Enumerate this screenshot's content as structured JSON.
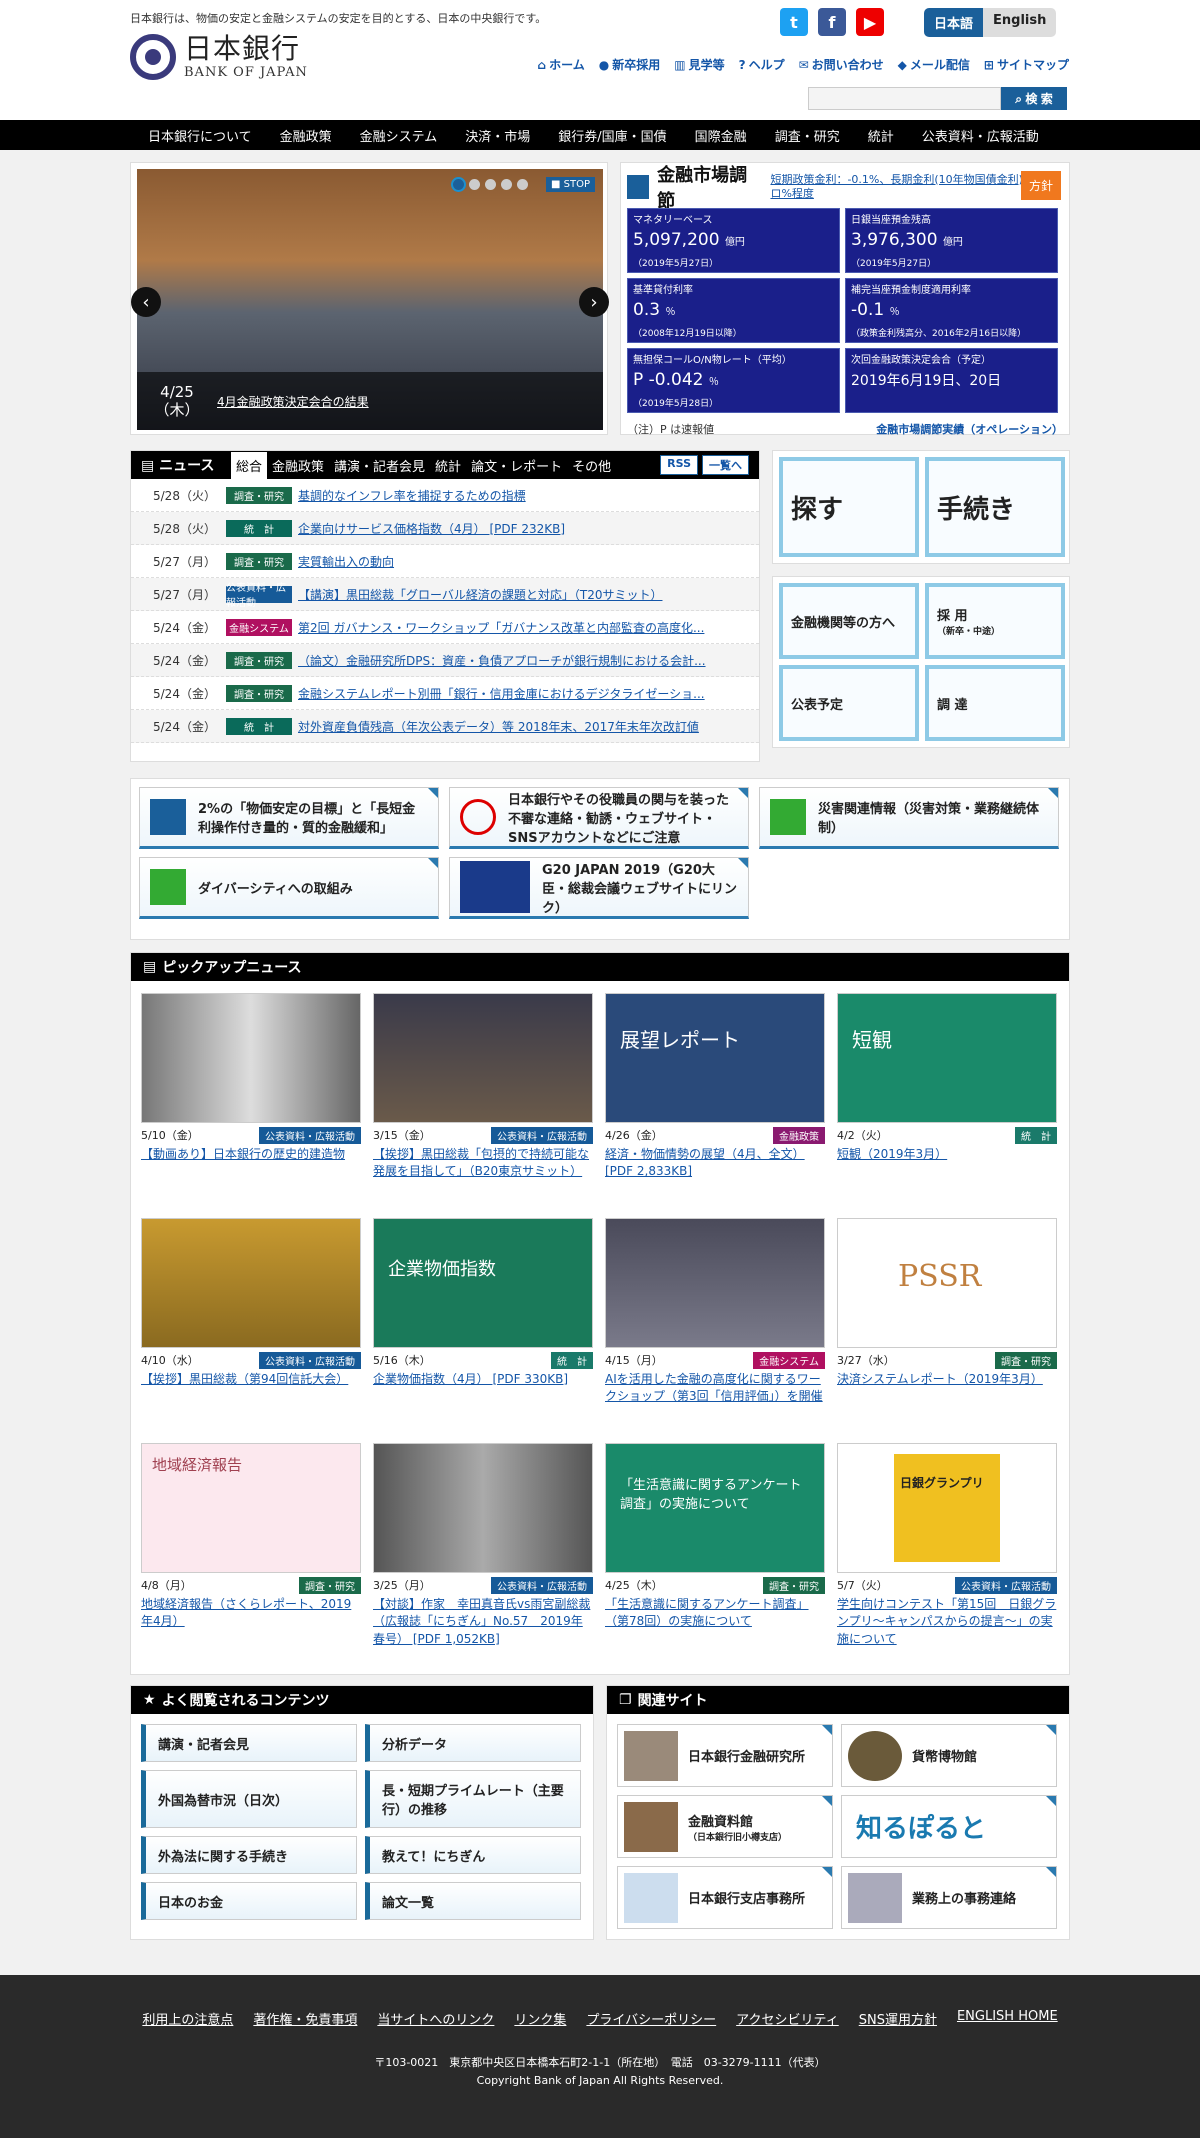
{
  "header": {
    "tagline": "日本銀行は、物価の安定と金融システムの安定を目的とする、日本の中央銀行です。",
    "logo_jp": "日本銀行",
    "logo_en": "BANK OF JAPAN",
    "lang_ja": "日本語",
    "lang_en": "English",
    "social": [
      "t",
      "f",
      "▶"
    ],
    "util": [
      "ホーム",
      "新卒採用",
      "見学等",
      "ヘルプ",
      "お問い合わせ",
      "メール配信",
      "サイトマップ"
    ],
    "search_button": "検 索"
  },
  "gnav": [
    "日本銀行について",
    "金融政策",
    "金融システム",
    "決済・市場",
    "銀行券/国庫・国債",
    "国際金融",
    "調査・研究",
    "統計",
    "公表資料・広報活動"
  ],
  "slideshow": {
    "stop": "STOP",
    "date": "4/25",
    "weekday": "（木）",
    "caption": "4月金融政策決定会合の結果"
  },
  "market": {
    "title": "金融市場調節",
    "rate_text": "短期政策金利：-0.1%、長期金利(10年物国債金利)：ゼロ%程度",
    "policy_button": "方針",
    "cells": [
      {
        "label": "マネタリーベース",
        "value": "5,097,200",
        "unit": "億円",
        "note": "（2019年5月27日）"
      },
      {
        "label": "日銀当座預金残高",
        "value": "3,976,300",
        "unit": "億円",
        "note": "（2019年5月27日）"
      },
      {
        "label": "基準貸付利率",
        "value": "0.3",
        "unit": "％",
        "note": "（2008年12月19日以降）"
      },
      {
        "label": "補完当座預金制度適用利率",
        "value": "-0.1",
        "unit": "％",
        "note": "（政策金利残高分、2016年2月16日以降）"
      },
      {
        "label": "無担保コールO/N物レート（平均）",
        "value": "P -0.042",
        "unit": "％",
        "note": "（2019年5月28日）"
      },
      {
        "label": "次回金融政策決定会合（予定）",
        "value": "2019年6月19日、20日",
        "unit": "",
        "note": ""
      }
    ],
    "footnote": "（注）P は速報値",
    "ops_link": "金融市場調節実績（オペレーション）"
  },
  "news": {
    "title": "ニュース",
    "tabs": [
      "総合",
      "金融政策",
      "講演・記者会見",
      "統計",
      "論文・レポート",
      "その他"
    ],
    "rss": "RSS",
    "list_btn": "一覧へ",
    "items": [
      {
        "date": "5/28（火）",
        "cat": "調査・研究",
        "text": "基調的なインフレ率を捕捉するための指標"
      },
      {
        "date": "5/28（火）",
        "cat": "統　計",
        "text": "企業向けサービス価格指数（4月） [PDF 232KB]"
      },
      {
        "date": "5/27（月）",
        "cat": "調査・研究",
        "text": "実質輸出入の動向"
      },
      {
        "date": "5/27（月）",
        "cat": "公表資料・広報活動",
        "text": "【講演】黒田総裁「グローバル経済の課題と対応」（T20サミット）"
      },
      {
        "date": "5/24（金）",
        "cat": "金融システム",
        "text": "第2回 ガバナンス・ワークショップ「ガバナンス改革と内部監査の高度化..."
      },
      {
        "date": "5/24（金）",
        "cat": "調査・研究",
        "text": "（論文）金融研究所DPS：資産・負債アプローチが銀行規制における会計..."
      },
      {
        "date": "5/24（金）",
        "cat": "調査・研究",
        "text": "金融システムレポート別冊「銀行・信用金庫におけるデジタライゼーショ..."
      },
      {
        "date": "5/24（金）",
        "cat": "統　計",
        "text": "対外資産負債残高（年次公表データ）等 2018年末、2017年末年次改訂値"
      }
    ]
  },
  "side_tiles": [
    "探す",
    "手続き"
  ],
  "side_tiles2": [
    "金融機関等の方へ",
    "採 用",
    "公表予定",
    "調 達"
  ],
  "side_tiles2_sub": "（新卒・中途）",
  "banners": [
    "2%の「物価安定の目標」と「長短金利操作付き量的・質的金融緩和」",
    "日本銀行やその役職員の関与を装った不審な連絡・勧誘・ウェブサイト・SNSアカウントなどにご注意",
    "災害関連情報（災害対策・業務継続体制）",
    "ダイバーシティへの取組み",
    "G20 JAPAN 2019（G20大臣・総裁会議ウェブサイトにリンク）"
  ],
  "pickup": {
    "title": "ピックアップニュース",
    "items": [
      {
        "date": "5/10（金）",
        "cat": "公表資料・広報活動",
        "text": "【動画あり】日本銀行の歴史的建造物"
      },
      {
        "date": "3/15（金）",
        "cat": "公表資料・広報活動",
        "text": "【挨拶】黒田総裁「包摂的で持続可能な発展を目指して」（B20東京サミット）"
      },
      {
        "date": "4/26（金）",
        "cat": "金融政策",
        "text": "経済・物価情勢の展望（4月、全文） [PDF 2,833KB]"
      },
      {
        "date": "4/2（火）",
        "cat": "統　計",
        "text": "短観（2019年3月）"
      },
      {
        "date": "4/10（水）",
        "cat": "公表資料・広報活動",
        "text": "【挨拶】黒田総裁（第94回信託大会）"
      },
      {
        "date": "5/16（木）",
        "cat": "統　計",
        "text": "企業物価指数（4月） [PDF 330KB]"
      },
      {
        "date": "4/15（月）",
        "cat": "金融システム",
        "text": "AIを活用した金融の高度化に関するワークショップ（第3回「信用評価」）を開催"
      },
      {
        "date": "3/27（水）",
        "cat": "調査・研究",
        "text": "決済システムレポート（2019年3月）"
      },
      {
        "date": "4/8（月）",
        "cat": "調査・研究",
        "text": "地域経済報告（さくらレポート、2019年4月）"
      },
      {
        "date": "3/25（月）",
        "cat": "公表資料・広報活動",
        "text": "【対談】作家　幸田真音氏vs雨宮副総裁（広報誌「にちぎん」No.57　2019年春号） [PDF 1,052KB]"
      },
      {
        "date": "4/25（木）",
        "cat": "調査・研究",
        "text": "「生活意識に関するアンケート調査」（第78回）の実施について"
      },
      {
        "date": "5/7（火）",
        "cat": "公表資料・広報活動",
        "text": "学生向けコンテスト「第15回　日銀グランプリ～キャンパスからの提言～」の実施について"
      }
    ],
    "img_texts": [
      "",
      "",
      "展望レポート",
      "短観",
      "",
      "企業物価指数",
      "",
      "PSSR",
      "地域経済報告",
      "",
      "「生活意識に関するアンケート調査」の実施について",
      "日銀グランプリ"
    ]
  },
  "popular": {
    "title": "よく閲覧されるコンテンツ",
    "items": [
      "講演・記者会見",
      "分析データ",
      "外国為替市況（日次）",
      "長・短期プライムレート（主要行）の推移",
      "外為法に関する手続き",
      "教えて！にちぎん",
      "日本のお金",
      "論文一覧"
    ]
  },
  "related": {
    "title": "関連サイト",
    "items": [
      "日本銀行金融研究所",
      "貨幣博物館",
      "金融資料館",
      "知るぽると",
      "日本銀行支店事務所",
      "業務上の事務連絡"
    ],
    "sub": "（日本銀行旧小樽支店）"
  },
  "footer": {
    "links": [
      "利用上の注意点",
      "著作権・免責事項",
      "当サイトへのリンク",
      "リンク集",
      "プライバシーポリシー",
      "アクセシビリティ",
      "SNS運用方針",
      "ENGLISH HOME"
    ],
    "address": "〒103-0021　東京都中央区日本橋本石町2-1-1（所在地）　電話　03-3279-1111（代表）",
    "copyright": "Copyright Bank of Japan All Rights Reserved."
  }
}
